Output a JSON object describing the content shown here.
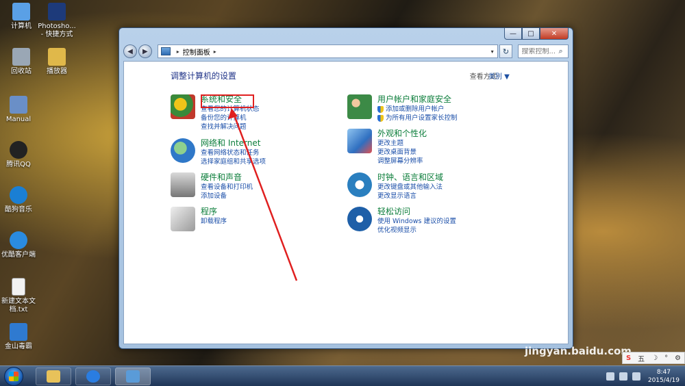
{
  "desktop": {
    "icons": [
      {
        "label": "计算机",
        "color": "#5aa0e6"
      },
      {
        "label": "Photosho... - 快捷方式",
        "color": "#1d3a7a"
      },
      {
        "label": "回收站",
        "color": "#9aa7b5"
      },
      {
        "label": "播放器",
        "color": "#e0b84a"
      },
      {
        "label": "Manual",
        "color": "#6a8fc7"
      },
      {
        "label": "腾讯QQ",
        "color": "#222222"
      },
      {
        "label": "酷狗音乐",
        "color": "#1a7fd4"
      },
      {
        "label": "优酷客户端",
        "color": "#2a8be0"
      },
      {
        "label": "新建文本文档.txt",
        "color": "#f2f2f2"
      },
      {
        "label": "金山毒霸",
        "color": "#2f7ad0"
      }
    ]
  },
  "window": {
    "controls": {
      "minimize": "—",
      "maximize": "□",
      "close": "✕"
    },
    "nav": {
      "back": "◀",
      "forward": "▶"
    },
    "address": {
      "crumb": "控制面板",
      "sep": "▸",
      "dropdown": "▾"
    },
    "refresh": "↻",
    "search": {
      "placeholder": "搜索控制...",
      "icon": "⌕"
    },
    "page_title": "调整计算机的设置",
    "view_by_label": "查看方式:",
    "view_by_value": "类别 ▼",
    "categories": [
      {
        "title": "系统和安全",
        "links": [
          "查看您的计算机状态",
          "备份您的计算机",
          "查找并解决问题"
        ],
        "icon_color": "#3a8a3a"
      },
      {
        "title": "网络和 Internet",
        "links": [
          "查看网络状态和任务",
          "选择家庭组和共享选项"
        ],
        "icon_color": "#2f78c8"
      },
      {
        "title": "硬件和声音",
        "links": [
          "查看设备和打印机",
          "添加设备"
        ],
        "icon_color": "#777777"
      },
      {
        "title": "程序",
        "links": [
          "卸载程序"
        ],
        "icon_color": "#9a9a9a"
      },
      {
        "title": "用户帐户和家庭安全",
        "links": [
          "添加或删除用户帐户",
          "为所有用户设置家长控制"
        ],
        "icon_color": "#3c8a46"
      },
      {
        "title": "外观和个性化",
        "links": [
          "更改主题",
          "更改桌面背景",
          "调整屏幕分辨率"
        ],
        "icon_color": "#2f6fc0"
      },
      {
        "title": "时钟、语言和区域",
        "links": [
          "更改键盘或其他输入法",
          "更改显示语言"
        ],
        "icon_color": "#2a7fbf"
      },
      {
        "title": "轻松访问",
        "links": [
          "使用 Windows 建议的设置",
          "优化视频显示"
        ],
        "icon_color": "#1e5fa8"
      }
    ]
  },
  "taskbar": {
    "apps": [
      {
        "name": "explorer",
        "color": "#e8c25a"
      },
      {
        "name": "sogou",
        "color": "#2a7de1"
      },
      {
        "name": "control-panel",
        "color": "#5a9bd8"
      }
    ],
    "time": "8:47",
    "date": "2015/4/19"
  },
  "ime": {
    "s": "S",
    "wu": "五",
    "moon": "☽",
    "dot": "°",
    "gear": "⚙"
  },
  "watermark": {
    "logo": "Bai du 经验",
    "url": "jingyan.baidu.com"
  }
}
